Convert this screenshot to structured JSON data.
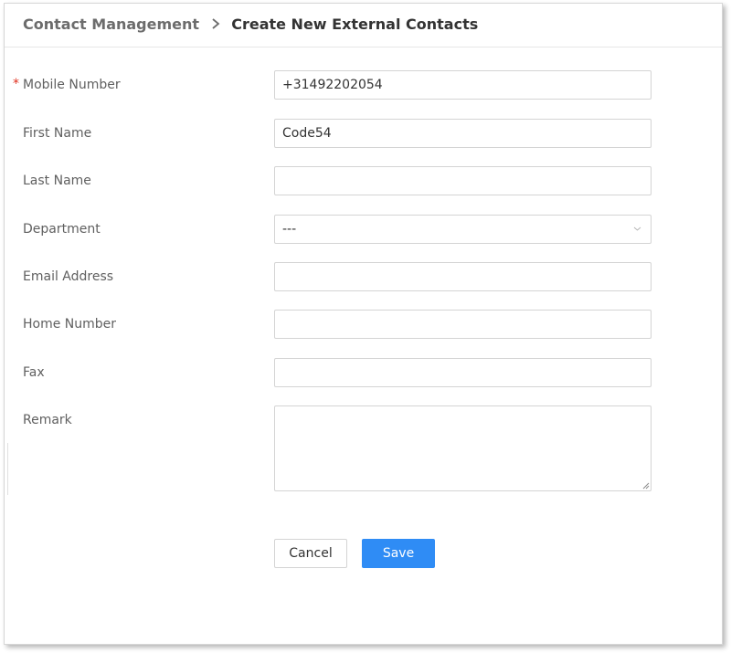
{
  "breadcrumb": {
    "parent": "Contact Management",
    "current": "Create New External Contacts"
  },
  "form": {
    "required_marker": "*",
    "mobile": {
      "label": "Mobile Number",
      "value": "+31492202054"
    },
    "first_name": {
      "label": "First Name",
      "value": "Code54"
    },
    "last_name": {
      "label": "Last Name",
      "value": ""
    },
    "department": {
      "label": "Department",
      "value": "---"
    },
    "email": {
      "label": "Email Address",
      "value": ""
    },
    "home": {
      "label": "Home Number",
      "value": ""
    },
    "fax": {
      "label": "Fax",
      "value": ""
    },
    "remark": {
      "label": "Remark",
      "value": ""
    }
  },
  "actions": {
    "cancel_label": "Cancel",
    "save_label": "Save"
  },
  "colors": {
    "primary": "#2f8cf5",
    "required": "#e0301e",
    "label_text": "#606060",
    "border": "#d4d4d4"
  },
  "icons": {
    "breadcrumb_separator": "chevron-right-icon",
    "select_arrow": "chevron-down-icon",
    "textarea_resize": "resize-grip-icon"
  }
}
